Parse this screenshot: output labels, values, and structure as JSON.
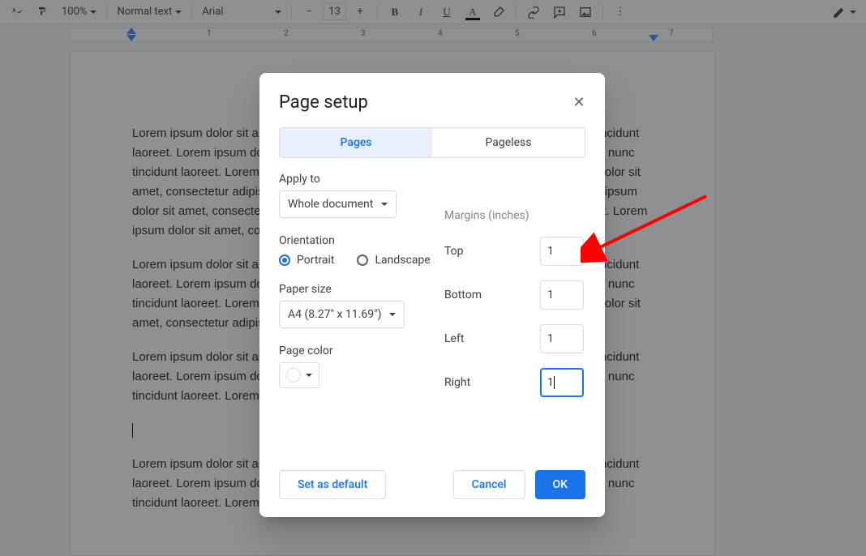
{
  "toolbar": {
    "zoom": "100%",
    "style": "Normal text",
    "font": "Arial",
    "font_size": "13"
  },
  "ruler": {
    "ticks": [
      "1",
      "2",
      "3",
      "4",
      "5",
      "6",
      "7"
    ]
  },
  "document": {
    "p1": "Lorem ipsum dolor sit amet, consectetur adipiscing elit. Etiam cursus lacus eget nunc tincidunt laoreet. Lorem ipsum dolor sit amet, consectetur adipiscing elit. Etiam cursus lacus eget nunc tincidunt laoreet. Lorem ipsum dolor sit amet, consectetur adipiscing elit. Lorem ipsum dolor sit amet, consectetur adipiscing elit. Etiam cursus lacus eget nunc tincidunt laoreet. Lorem ipsum dolor sit amet, consectetur adipiscing elit. Etiam cursus lacus eget nunc tincidunt laoreet. Lorem ipsum dolor sit amet, consectetur adipiscing elit.",
    "p2": "Lorem ipsum dolor sit amet, consectetur adipiscing elit. Etiam cursus lacus eget nunc tincidunt laoreet. Lorem ipsum dolor sit amet, consectetur adipiscing elit. Etiam cursus lacus eget nunc tincidunt laoreet. Lorem ipsum dolor sit amet, consectetur adipiscing elit. Lorem ipsum dolor sit amet, consectetur adipiscing elit. Etiam cursus lacus eget nunc tincidunt laoreet.",
    "p3": "Lorem ipsum dolor sit amet, consectetur adipiscing elit. Etiam cursus lacus eget nunc tincidunt laoreet. Lorem ipsum dolor sit amet, consectetur adipiscing elit. Etiam cursus lacus eget nunc tincidunt laoreet. Lorem ipsum dolor sit amet, consectetur adipiscing elit.",
    "p4": "Lorem ipsum dolor sit amet, consectetur adipiscing elit. Etiam cursus lacus eget nunc tincidunt laoreet. Lorem ipsum dolor sit amet, consectetur adipiscing elit. Etiam cursus lacus eget nunc tincidunt laoreet. Lorem ipsum dolor sit amet, consectetur adipiscing elit."
  },
  "dialog": {
    "title": "Page setup",
    "tabs": {
      "pages": "Pages",
      "pageless": "Pageless"
    },
    "apply_to_label": "Apply to",
    "apply_to_value": "Whole document",
    "orientation_label": "Orientation",
    "orientation": {
      "portrait": "Portrait",
      "landscape": "Landscape"
    },
    "paper_size_label": "Paper size",
    "paper_size_value": "A4 (8.27\" x 11.69\")",
    "page_color_label": "Page color",
    "margins_label": "Margins",
    "margins_unit": "(inches)",
    "margins": {
      "top_label": "Top",
      "top_value": "1",
      "bottom_label": "Bottom",
      "bottom_value": "1",
      "left_label": "Left",
      "left_value": "1",
      "right_label": "Right",
      "right_value": "1"
    },
    "set_default": "Set as default",
    "cancel": "Cancel",
    "ok": "OK"
  }
}
